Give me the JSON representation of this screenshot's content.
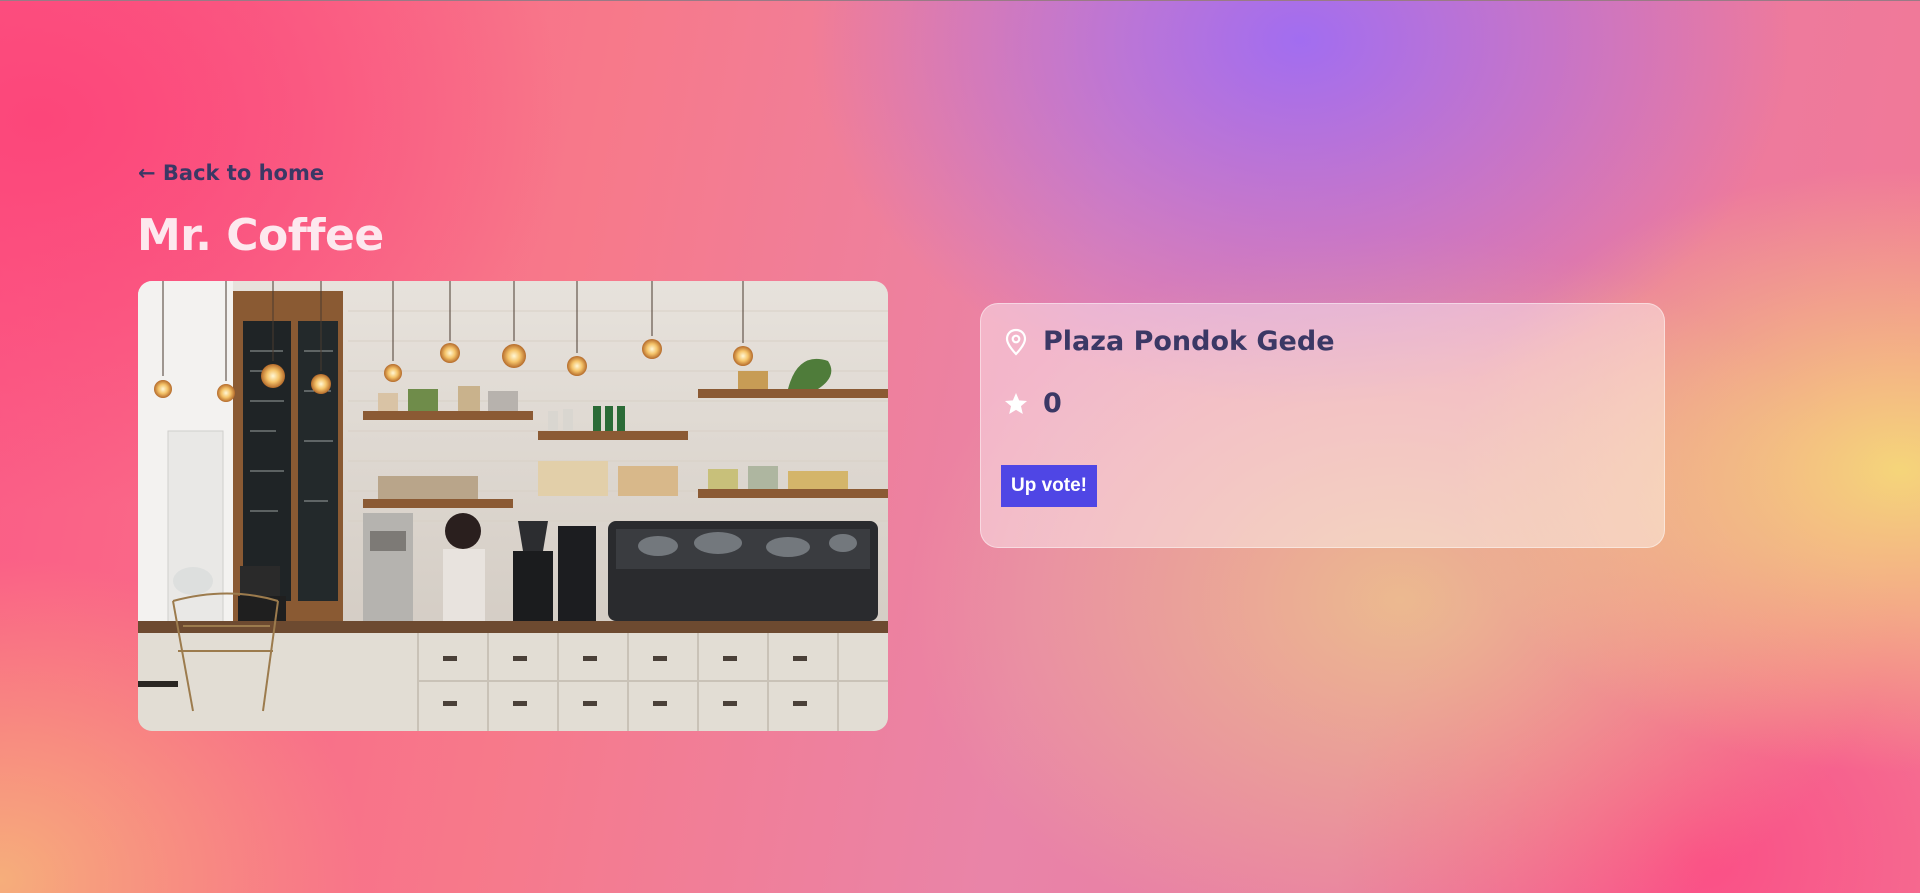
{
  "nav": {
    "back_label": "← Back to home"
  },
  "store": {
    "name": "Mr. Coffee",
    "location": "Plaza Pondok Gede",
    "votes": "0"
  },
  "actions": {
    "upvote_label": "Up vote!"
  },
  "icons": {
    "location": "map-pin-icon",
    "rating": "star-icon"
  },
  "colors": {
    "accent": "#4f46e5",
    "text_dark": "#3b3865",
    "title": "#fde8ee"
  }
}
